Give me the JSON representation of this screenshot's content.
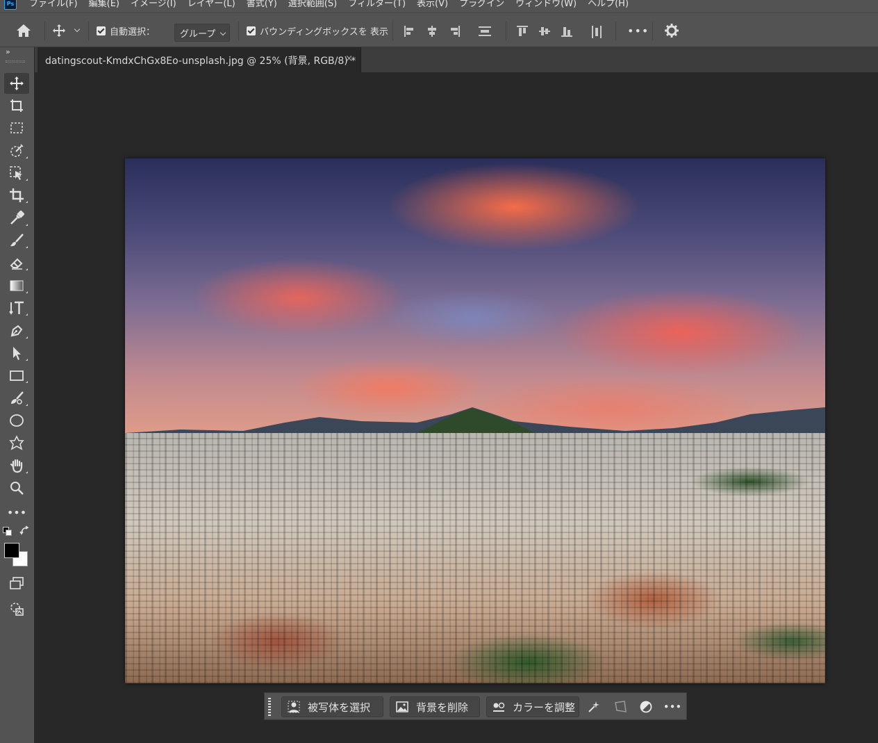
{
  "menubar": {
    "app_logo": "Ps",
    "items": [
      "ファイル(F)",
      "編集(E)",
      "イメージ(I)",
      "レイヤー(L)",
      "書式(Y)",
      "選択範囲(S)",
      "フィルター(T)",
      "表示(V)",
      "プラグイン",
      "ウィンドウ(W)",
      "ヘルプ(H)"
    ]
  },
  "options": {
    "auto_select_label": "自動選択：",
    "auto_select_checked": true,
    "auto_select_target": "グループ",
    "bounding_box_label": "バウンディングボックスを 表示",
    "bounding_box_checked": true,
    "more_label": "•••"
  },
  "document": {
    "tab_title": "datingscout-KmdxChGx8Eo-unsplash.jpg @ 25% (背景, RGB/8) *",
    "close_glyph": "×"
  },
  "tools": {
    "collapse_glyph": "»",
    "items": [
      "move-tool",
      "artboard-tool",
      "rectangular-marquee-tool",
      "object-selection-tool",
      "quick-selection-tool",
      "crop-tool",
      "eyedropper-tool",
      "brush-tool",
      "eraser-tool",
      "gradient-tool",
      "type-tool",
      "pen-tool",
      "path-selection-tool",
      "rectangle-tool",
      "remove-tool",
      "ellipse-tool",
      "custom-shape-tool",
      "hand-tool",
      "zoom-tool",
      "edit-toolbar",
      "default-colors",
      "swap-colors",
      "foreground-background-colors",
      "screen-mode",
      "quick-mask"
    ],
    "more_label": "•••",
    "foreground_color": "#000000",
    "background_color": "#ffffff"
  },
  "taskbar": {
    "select_subject_label": "被写体を選択",
    "remove_background_label": "背景を削除",
    "adjust_color_label": "カラーを調整",
    "more_label": "•••"
  },
  "colors": {
    "panel": "#535353",
    "workspace": "#282828",
    "tab_row": "#3c3c3c",
    "accent": "#31a8ff"
  }
}
